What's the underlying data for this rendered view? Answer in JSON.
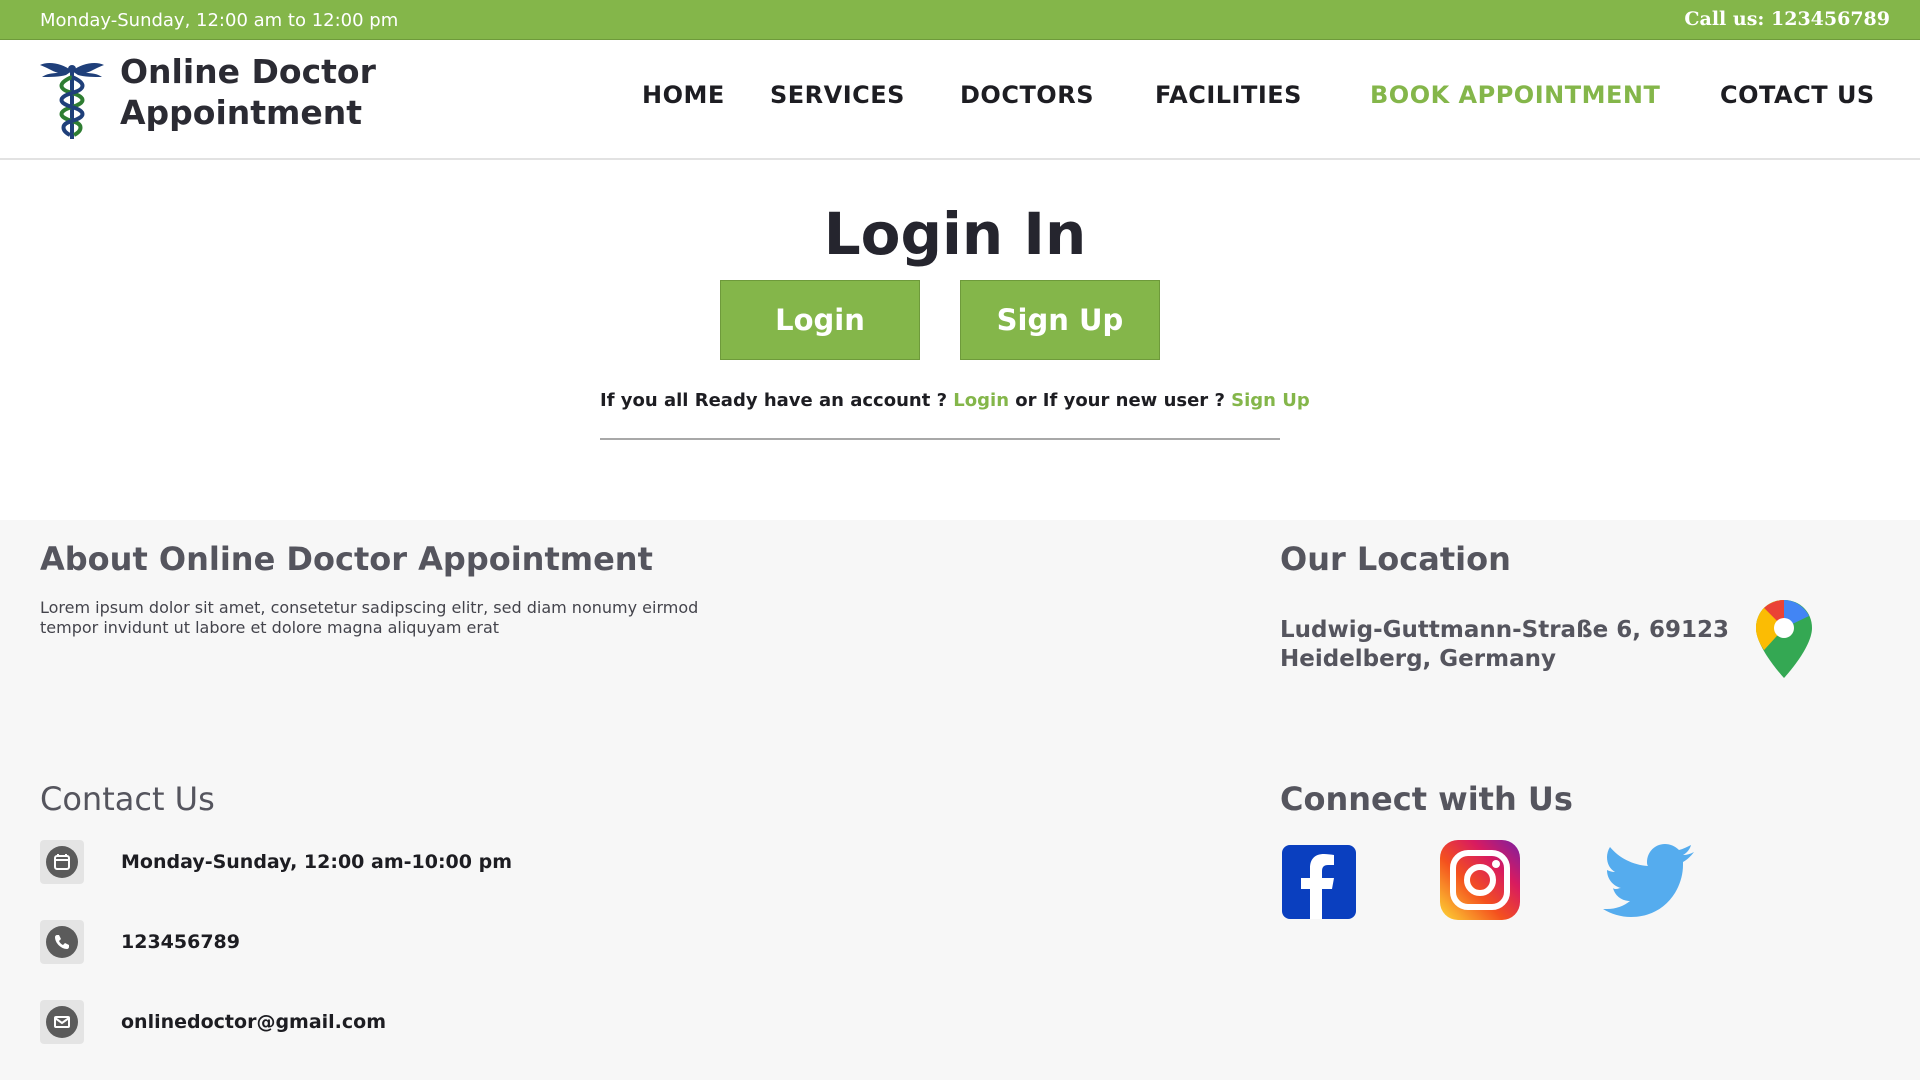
{
  "topbar": {
    "hours": "Monday-Sunday, 12:00 am to 12:00 pm",
    "call": "Call us: 123456789"
  },
  "brand": {
    "title_line1": "Online Doctor",
    "title_line2": "Appointment",
    "icon": "caduceus-icon"
  },
  "nav": {
    "items": [
      {
        "label": "HOME"
      },
      {
        "label": "SERVICES"
      },
      {
        "label": "DOCTORS"
      },
      {
        "label": "FACILITIES"
      },
      {
        "label": "BOOK  APPOINTMENT",
        "active": true
      },
      {
        "label": "COTACT US"
      }
    ]
  },
  "main": {
    "title": "Login In",
    "login_button": "Login",
    "signup_button": "Sign Up",
    "prompt_part1": "If you all Ready have an account ? ",
    "prompt_login": "Login",
    "prompt_part2": " or If your new user ? ",
    "prompt_signup": "Sign Up"
  },
  "footer": {
    "about_title": "About Online Doctor Appointment",
    "about_text": "Lorem ipsum dolor sit amet, consetetur sadipscing elitr, sed diam  nonumy eirmod tempor invidunt ut labore et dolore magna aliquyam erat",
    "location_title": "Our Location",
    "address_line1": "Ludwig-Guttmann-Straße 6, 69123",
    "address_line2": "Heidelberg, Germany",
    "location_icon": "google-maps-pin-icon",
    "contact_title": "Contact Us",
    "contact_items": [
      {
        "icon": "calendar-icon",
        "text": "Monday-Sunday, 12:00 am-10:00 pm"
      },
      {
        "icon": "phone-icon",
        "text": "123456789"
      },
      {
        "icon": "email-icon",
        "text": "onlinedoctor@gmail.com"
      }
    ],
    "connect_title": "Connect with Us",
    "social": [
      {
        "icon": "facebook-icon"
      },
      {
        "icon": "instagram-icon"
      },
      {
        "icon": "twitter-icon"
      }
    ]
  },
  "colors": {
    "accent": "#84b64a",
    "footer_bg": "#f7f7f7",
    "heading": "#55555e",
    "text_dark": "#1d1d22"
  }
}
